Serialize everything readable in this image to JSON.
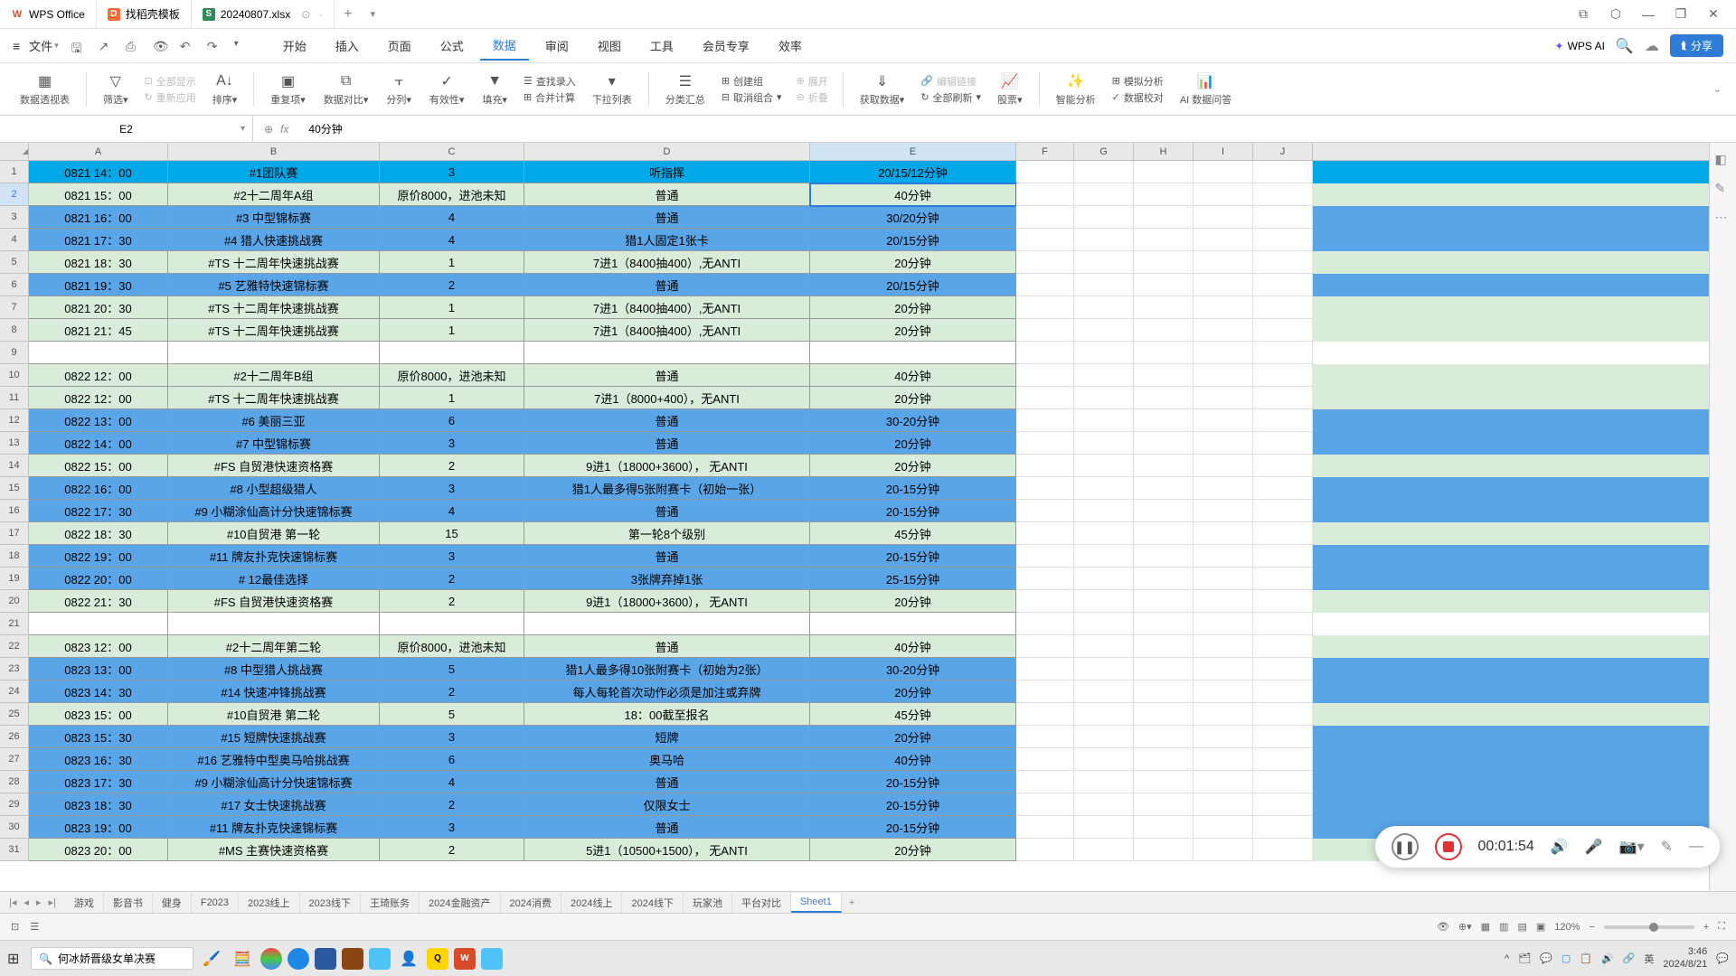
{
  "titlebar": {
    "tab1": "WPS Office",
    "tab2": "找稻壳模板",
    "tab3": "20240807.xlsx"
  },
  "menubar": {
    "file": "文件",
    "start": "开始",
    "insert": "插入",
    "page": "页面",
    "formula": "公式",
    "data": "数据",
    "review": "审阅",
    "view": "视图",
    "tools": "工具",
    "member": "会员专享",
    "effect": "效率",
    "wpsai": "WPS AI",
    "share": "分享"
  },
  "ribbon": {
    "pivot": "数据透视表",
    "filter": "筛选",
    "showall": "全部显示",
    "reapply": "重新应用",
    "sort": "排序",
    "dup": "重复项",
    "compare": "数据对比",
    "split": "分列",
    "valid": "有效性",
    "fill": "填充",
    "findentry": "查找录入",
    "merge": "合并计算",
    "dropdown": "下拉列表",
    "subtotal": "分类汇总",
    "group": "创建组",
    "ungroup": "取消组合",
    "expand": "展开",
    "collapse": "折叠",
    "getdata": "获取数据",
    "editlink": "编辑链接",
    "refreshall": "全部刷新",
    "stock": "股票",
    "smart": "智能分析",
    "sim": "模拟分析",
    "validate": "数据校对",
    "aiq": "AI 数据问答"
  },
  "formula": {
    "namebox": "E2",
    "value": "40分钟"
  },
  "columns": [
    "A",
    "B",
    "C",
    "D",
    "E",
    "F",
    "G",
    "H",
    "I",
    "J"
  ],
  "rows": [
    {
      "n": 1,
      "cls": "row-header-row",
      "a": "0821 14：00",
      "b": "#1团队赛",
      "c": "3",
      "d": "听指挥",
      "e": "20/15/12分钟"
    },
    {
      "n": 2,
      "cls": "row-light",
      "a": "0821 15：00",
      "b": "#2十二周年A组",
      "c": "原价8000，进池未知",
      "d": "普通",
      "e": "40分钟",
      "sel": true
    },
    {
      "n": 3,
      "cls": "row-blue",
      "a": "0821 16：00",
      "b": "#3 中型锦标赛",
      "c": "4",
      "d": "普通",
      "e": "30/20分钟"
    },
    {
      "n": 4,
      "cls": "row-blue",
      "a": "0821 17：30",
      "b": "#4 猎人快速挑战赛",
      "c": "4",
      "d": "猎1人固定1张卡",
      "e": "20/15分钟"
    },
    {
      "n": 5,
      "cls": "row-light",
      "a": "0821 18：30",
      "b": "#TS 十二周年快速挑战赛",
      "c": "1",
      "d": "7进1（8400抽400）,无ANTI",
      "e": "20分钟"
    },
    {
      "n": 6,
      "cls": "row-blue",
      "a": "0821 19：30",
      "b": "#5 艺雅特快速锦标赛",
      "c": "2",
      "d": "普通",
      "e": "20/15分钟"
    },
    {
      "n": 7,
      "cls": "row-light",
      "a": "0821 20：30",
      "b": "#TS 十二周年快速挑战赛",
      "c": "1",
      "d": "7进1（8400抽400）,无ANTI",
      "e": "20分钟"
    },
    {
      "n": 8,
      "cls": "row-light",
      "a": "0821 21：45",
      "b": "#TS 十二周年快速挑战赛",
      "c": "1",
      "d": "7进1（8400抽400）,无ANTI",
      "e": "20分钟"
    },
    {
      "n": 9,
      "cls": "row-empty",
      "a": "",
      "b": "",
      "c": "",
      "d": "",
      "e": ""
    },
    {
      "n": 10,
      "cls": "row-light",
      "a": "0822 12：00",
      "b": "#2十二周年B组",
      "c": "原价8000，进池未知",
      "d": "普通",
      "e": "40分钟"
    },
    {
      "n": 11,
      "cls": "row-light",
      "a": "0822 12：00",
      "b": "#TS 十二周年快速挑战赛",
      "c": "1",
      "d": "7进1（8000+400），无ANTI",
      "e": "20分钟"
    },
    {
      "n": 12,
      "cls": "row-blue",
      "a": "0822 13：00",
      "b": "#6 美丽三亚",
      "c": "6",
      "d": "普通",
      "e": "30-20分钟"
    },
    {
      "n": 13,
      "cls": "row-blue",
      "a": "0822 14：00",
      "b": "#7 中型锦标赛",
      "c": "3",
      "d": "普通",
      "e": "20分钟"
    },
    {
      "n": 14,
      "cls": "row-light",
      "a": "0822 15：00",
      "b": "#FS 自贸港快速资格赛",
      "c": "2",
      "d": "9进1（18000+3600）， 无ANTI",
      "e": "20分钟"
    },
    {
      "n": 15,
      "cls": "row-blue",
      "a": "0822 16：00",
      "b": "#8 小型超级猎人",
      "c": "3",
      "d": "猎1人最多得5张附赛卡（初始一张）",
      "e": "20-15分钟"
    },
    {
      "n": 16,
      "cls": "row-blue",
      "a": "0822 17：30",
      "b": "#9 小糊涂仙高计分快速锦标赛",
      "c": "4",
      "d": "普通",
      "e": "20-15分钟"
    },
    {
      "n": 17,
      "cls": "row-light",
      "a": "0822 18：30",
      "b": "#10自贸港 第一轮",
      "c": "15",
      "d": "第一轮8个级别",
      "e": "45分钟"
    },
    {
      "n": 18,
      "cls": "row-blue",
      "a": "0822 19：00",
      "b": "#11 牌友扑克快速锦标赛",
      "c": "3",
      "d": "普通",
      "e": "20-15分钟"
    },
    {
      "n": 19,
      "cls": "row-blue",
      "a": "0822 20：00",
      "b": "# 12最佳选择",
      "c": "2",
      "d": "3张牌弃掉1张",
      "e": "25-15分钟"
    },
    {
      "n": 20,
      "cls": "row-light",
      "a": "0822 21：30",
      "b": "#FS 自贸港快速资格赛",
      "c": "2",
      "d": "9进1（18000+3600）， 无ANTI",
      "e": "20分钟"
    },
    {
      "n": 21,
      "cls": "row-empty",
      "a": "",
      "b": "",
      "c": "",
      "d": "",
      "e": ""
    },
    {
      "n": 22,
      "cls": "row-light",
      "a": "0823 12：00",
      "b": "#2十二周年第二轮",
      "c": "原价8000，进池未知",
      "d": "普通",
      "e": "40分钟"
    },
    {
      "n": 23,
      "cls": "row-blue",
      "a": "0823 13：00",
      "b": "#8 中型猎人挑战赛",
      "c": "5",
      "d": "猎1人最多得10张附赛卡（初始为2张）",
      "e": "30-20分钟"
    },
    {
      "n": 24,
      "cls": "row-blue",
      "a": "0823 14：30",
      "b": "#14 快速冲锋挑战赛",
      "c": "2",
      "d": "每人每轮首次动作必须是加注或弃牌",
      "e": "20分钟"
    },
    {
      "n": 25,
      "cls": "row-light",
      "a": "0823 15：00",
      "b": "#10自贸港 第二轮",
      "c": "5",
      "d": "18：00截至报名",
      "e": "45分钟"
    },
    {
      "n": 26,
      "cls": "row-blue",
      "a": "0823 15：30",
      "b": "#15 短牌快速挑战赛",
      "c": "3",
      "d": "短牌",
      "e": "20分钟"
    },
    {
      "n": 27,
      "cls": "row-blue",
      "a": "0823 16：30",
      "b": "#16 艺雅特中型奥马哈挑战赛",
      "c": "6",
      "d": "奥马哈",
      "e": "40分钟"
    },
    {
      "n": 28,
      "cls": "row-blue",
      "a": "0823 17：30",
      "b": "#9 小糊涂仙高计分快速锦标赛",
      "c": "4",
      "d": "普通",
      "e": "20-15分钟"
    },
    {
      "n": 29,
      "cls": "row-blue",
      "a": "0823 18：30",
      "b": "#17 女士快速挑战赛",
      "c": "2",
      "d": "仅限女士",
      "e": "20-15分钟"
    },
    {
      "n": 30,
      "cls": "row-blue",
      "a": "0823 19：00",
      "b": "#11 牌友扑克快速锦标赛",
      "c": "3",
      "d": "普通",
      "e": "20-15分钟"
    },
    {
      "n": 31,
      "cls": "row-light",
      "a": "0823 20：00",
      "b": "#MS 主赛快速资格赛",
      "c": "2",
      "d": "5进1（10500+1500）， 无ANTI",
      "e": "20分钟"
    }
  ],
  "sheets": {
    "s1": "游戏",
    "s2": "影音书",
    "s3": "健身",
    "s4": "F2023",
    "s5": "2023线上",
    "s6": "2023线下",
    "s7": "王琦账务",
    "s8": "2024金融资产",
    "s9": "2024消费",
    "s10": "2024线上",
    "s11": "2024线下",
    "s12": "玩家池",
    "s13": "平台对比",
    "s14": "Sheet1"
  },
  "status": {
    "zoom": "120%"
  },
  "rec": {
    "time": "00:01:54"
  },
  "taskbar": {
    "search": "何冰娇晋级女单决赛",
    "time": "3:46",
    "date": "2024/8/21"
  }
}
